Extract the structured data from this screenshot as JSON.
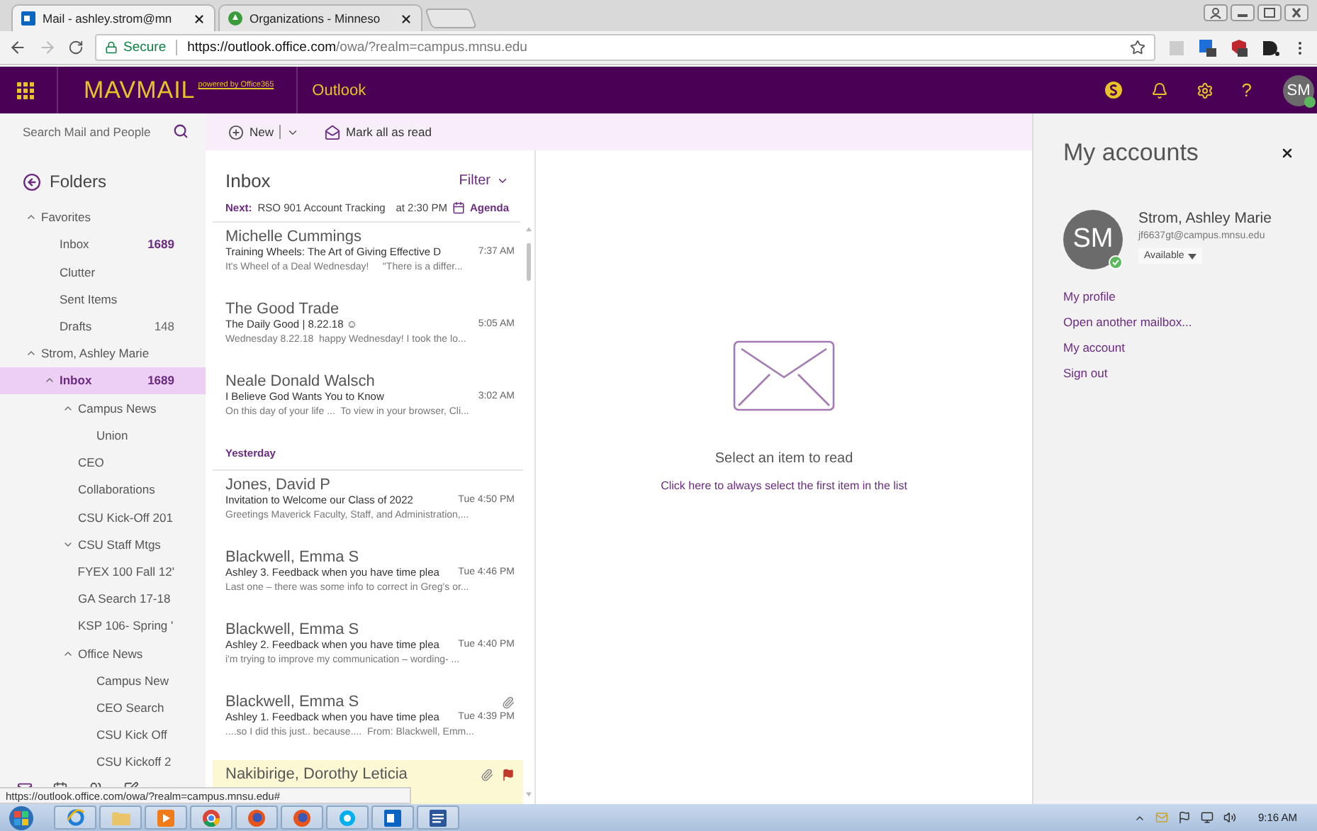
{
  "browser": {
    "tabs": [
      {
        "title": "Mail - ashley.strom@mn",
        "selected": true,
        "kind": "mail"
      },
      {
        "title": "Organizations - Minneso",
        "selected": false,
        "kind": "org"
      }
    ],
    "secure_label": "Secure",
    "url_host": "https://outlook.office.com",
    "url_path": "/owa/?realm=campus.mnsu.edu"
  },
  "header": {
    "brand": "MAVMAIL",
    "powered": "powered by Office365",
    "app": "Outlook",
    "help": "?",
    "avatar": "SM"
  },
  "sidebar": {
    "search_placeholder": "Search Mail and People",
    "folders_title": "Folders",
    "tree": [
      {
        "label": "Favorites",
        "selected": false,
        "expanded": true,
        "children": [
          {
            "label": "Inbox",
            "selected": false,
            "count": "1689",
            "count_unread": true
          },
          {
            "label": "Clutter",
            "selected": false
          },
          {
            "label": "Sent Items",
            "selected": false
          },
          {
            "label": "Drafts",
            "selected": false,
            "count": "148",
            "count_unread": false
          }
        ]
      },
      {
        "label": "Strom, Ashley Marie",
        "selected": false,
        "expanded": true,
        "children": [
          {
            "label": "Inbox",
            "selected": true,
            "expanded": true,
            "count": "1689",
            "count_unread": true,
            "children": [
              {
                "label": "Campus News",
                "selected": false,
                "expanded": true,
                "children": [
                  {
                    "label": "Union",
                    "selected": false
                  }
                ]
              },
              {
                "label": "CEO",
                "selected": false
              },
              {
                "label": "Collaborations",
                "selected": false
              },
              {
                "label": "CSU Kick-Off 201",
                "selected": false
              },
              {
                "label": "CSU Staff Mtgs",
                "selected": false,
                "expanded": false
              },
              {
                "label": "FYEX 100 Fall 12'",
                "selected": false
              },
              {
                "label": "GA Search 17-18",
                "selected": false
              },
              {
                "label": "KSP 106- Spring '",
                "selected": false
              },
              {
                "label": "Office News",
                "selected": false,
                "expanded": true,
                "children": [
                  {
                    "label": "Campus New",
                    "selected": false
                  },
                  {
                    "label": "CEO Search",
                    "selected": false
                  },
                  {
                    "label": "CSU Kick Off",
                    "selected": false
                  },
                  {
                    "label": "CSU Kickoff 2",
                    "selected": false
                  }
                ]
              }
            ]
          }
        ]
      }
    ]
  },
  "toolbar": {
    "new": "New",
    "mark_all": "Mark all as read"
  },
  "list": {
    "title": "Inbox",
    "filter": "Filter",
    "next": {
      "label": "Next:",
      "subject": "RSO 901 Account Tracking",
      "time": "at 2:30 PM",
      "agenda": "Agenda"
    },
    "groups": [
      {
        "messages": [
          {
            "sender": "Michelle Cummings",
            "subject": "Training Wheels: The Art of Giving Effective D",
            "time": "7:37 AM",
            "preview": "It's Wheel of a Deal Wednesday!     \"There is a differ...",
            "attachment": false,
            "flagged": false
          },
          {
            "sender": "The Good Trade",
            "subject": "The Daily Good | 8.22.18 ☺",
            "time": "5:05 AM",
            "preview": "Wednesday 8.22.18  happy Wednesday! I took the lo...",
            "attachment": false,
            "flagged": false
          },
          {
            "sender": "Neale Donald Walsch",
            "subject": "I Believe God Wants You to Know",
            "time": "3:02 AM",
            "preview": "On this day of your life ...  To view in your browser, Cli...",
            "attachment": false,
            "flagged": false
          }
        ]
      },
      {
        "heading": "Yesterday",
        "messages": [
          {
            "sender": "Jones, David P",
            "subject": "Invitation to Welcome our Class of 2022",
            "time": "Tue 4:50 PM",
            "preview": "Greetings Maverick Faculty, Staff, and Administration,...",
            "attachment": false,
            "flagged": false
          },
          {
            "sender": "Blackwell, Emma S",
            "subject": "Ashley 3. Feedback when you have time plea",
            "time": "Tue 4:46 PM",
            "preview": "Last one – there was some info to correct in Greg's or...",
            "attachment": false,
            "flagged": false
          },
          {
            "sender": "Blackwell, Emma S",
            "subject": "Ashley 2. Feedback when you have time plea",
            "time": "Tue 4:40 PM",
            "preview": "i'm trying to improve my communication – wording- ...",
            "attachment": false,
            "flagged": false
          },
          {
            "sender": "Blackwell, Emma S",
            "subject": "Ashley 1. Feedback when you have time plea",
            "time": "Tue 4:39 PM",
            "preview": "....so I did this just.. because....  From: Blackwell, Emm...",
            "attachment": true,
            "flagged": false
          },
          {
            "sender": "Nakibirige, Dorothy Leticia",
            "attachment": true,
            "flagged": true
          }
        ]
      }
    ]
  },
  "reading": {
    "message": "Select an item to read",
    "link": "Click here to always select the first item in the list"
  },
  "accounts": {
    "title": "My accounts",
    "name": "Strom, Ashley Marie",
    "email": "jf6637gt@campus.mnsu.edu",
    "avatar": "SM",
    "status": "Available",
    "links": [
      "My profile",
      "Open another mailbox...",
      "My account",
      "Sign out"
    ]
  },
  "status_url": "https://outlook.office.com/owa/?realm=campus.mnsu.edu#",
  "taskbar": {
    "apps": [
      {
        "kind": "ie"
      },
      {
        "kind": "folder"
      },
      {
        "kind": "media"
      },
      {
        "kind": "chrome"
      },
      {
        "kind": "firefox"
      },
      {
        "kind": "firefox"
      },
      {
        "kind": "skype"
      },
      {
        "kind": "outlook"
      },
      {
        "kind": "word"
      }
    ],
    "time": "9:16 AM"
  }
}
